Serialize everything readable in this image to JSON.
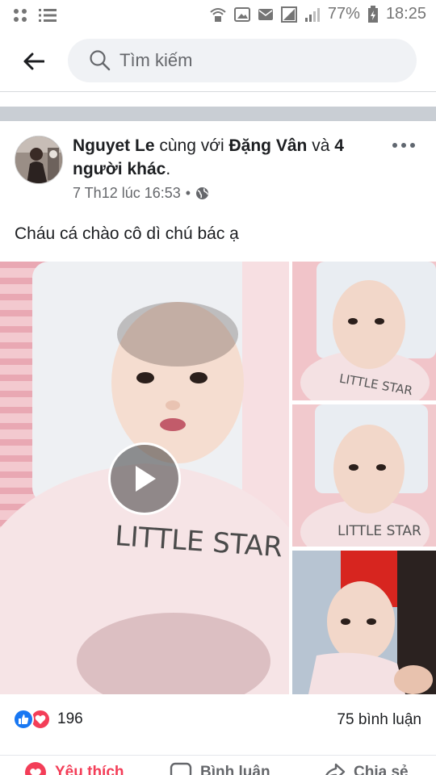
{
  "status_bar": {
    "battery_percent": "77%",
    "time": "18:25"
  },
  "search": {
    "placeholder": "Tìm kiếm"
  },
  "post": {
    "author": "Nguyet Le",
    "with_text": " cùng với ",
    "tagged": "Đặng Vân",
    "and_text": " và ",
    "others": "4 người khác",
    "period": ".",
    "timestamp": "7 Th12 lúc 16:53",
    "separator": "•",
    "privacy_icon": "globe-icon",
    "text": "Cháu cá chào cô dì chú bác ạ",
    "media": [
      {
        "type": "video",
        "description": "baby-little-star"
      },
      {
        "type": "photo",
        "description": "baby-little-star"
      },
      {
        "type": "photo",
        "description": "baby-little-star"
      },
      {
        "type": "photo",
        "description": "baby-held"
      }
    ],
    "reaction_count": "196",
    "comment_count": "75 bình luận"
  },
  "actions": {
    "like": "Yêu thích",
    "comment": "Bình luận",
    "share": "Chia sẻ"
  },
  "colors": {
    "like_blue": "#1877f2",
    "love_red": "#f33e58",
    "text_secondary": "#65676b"
  }
}
